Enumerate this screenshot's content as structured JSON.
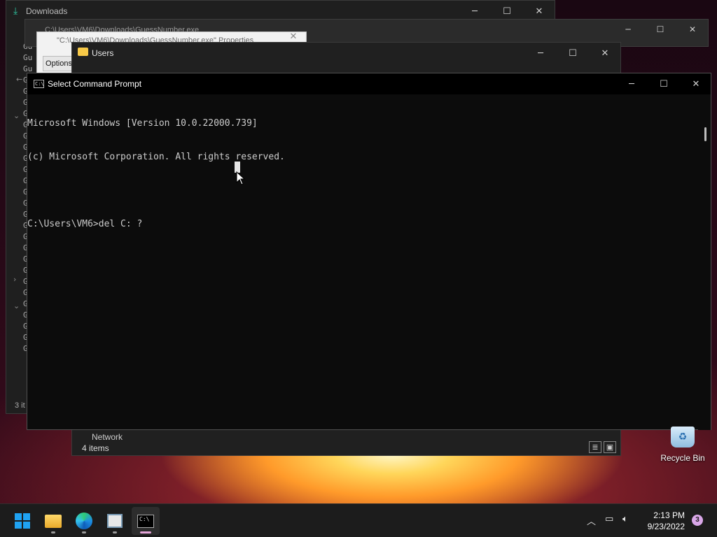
{
  "windows": {
    "downloads": {
      "title": "Downloads",
      "list_items": [
        "Gu",
        "Gu",
        "Gu",
        "G",
        "G",
        "G",
        "G",
        "G",
        "G",
        "G",
        "G",
        "G",
        "G",
        "G",
        "G",
        "G",
        "G",
        "G",
        "G",
        "G",
        "G",
        "G",
        "G",
        "G",
        "G",
        "G",
        "G",
        "G"
      ],
      "status": "3 it"
    },
    "guess": {
      "title": "C:\\Users\\VM6\\Downloads\\GuessNumber.exe"
    },
    "properties": {
      "title": "\"C:\\Users\\VM6\\Downloads\\GuessNumber.exe\" Properties",
      "tab_options": "Options"
    },
    "users": {
      "title": "Users",
      "network_label": "Network",
      "status": "4 items"
    },
    "cmd": {
      "title": "Select Command Prompt",
      "lines": [
        "Microsoft Windows [Version 10.0.22000.739]",
        "(c) Microsoft Corporation. All rights reserved.",
        "",
        "C:\\Users\\VM6>del C: ?"
      ]
    }
  },
  "desktop": {
    "recycle_bin_label": "Recycle Bin"
  },
  "taskbar": {
    "time": "2:13 PM",
    "date": "9/23/2022",
    "notification_count": "3",
    "apps": [
      "start",
      "file-explorer",
      "edge",
      "properties-app",
      "command-prompt"
    ]
  },
  "icons": {
    "minimize": "─",
    "maximize": "☐",
    "close": "✕",
    "chevron_up": "︿"
  }
}
